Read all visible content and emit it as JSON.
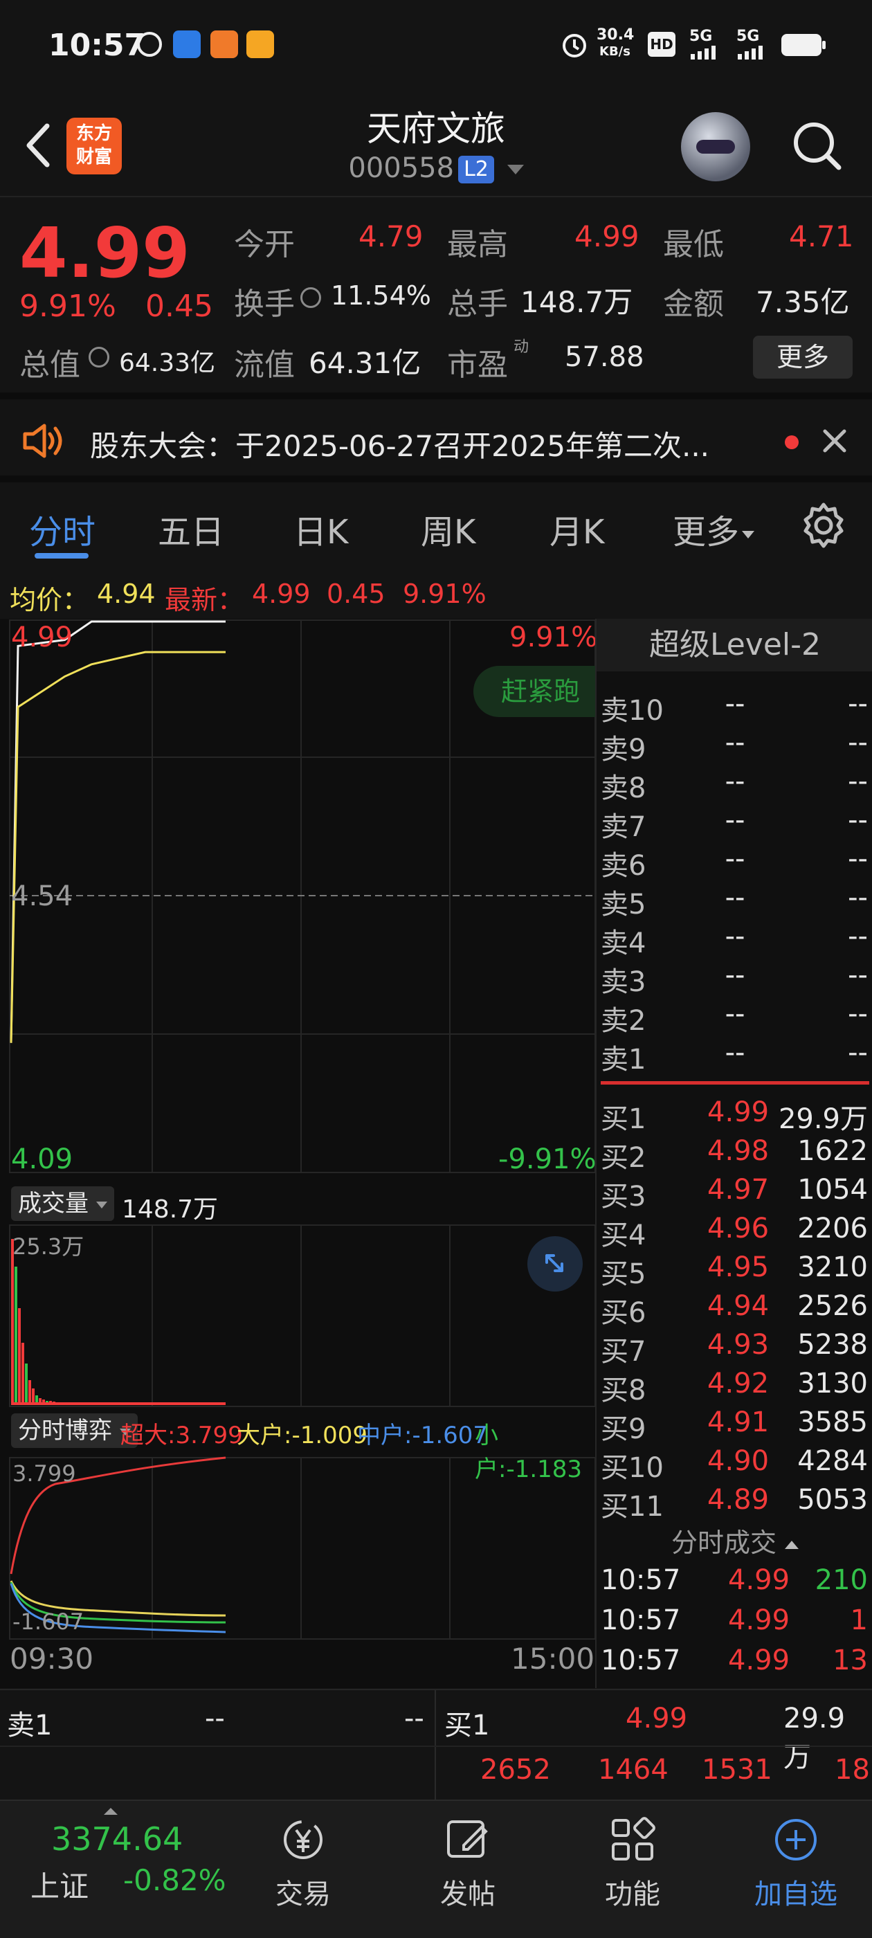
{
  "status_bar": {
    "time": "10:57",
    "speed_value": "30.4",
    "speed_unit": "KB/s",
    "network1": "5G",
    "network2": "5G",
    "icons": [
      "circle-k-icon",
      "app-icon-blue",
      "app-icon-orange",
      "app-icon-video",
      "alarm-icon",
      "hd-icon",
      "signal-icon",
      "battery-icon"
    ]
  },
  "header": {
    "logo_line1": "东方",
    "logo_line2": "财富",
    "title": "天府文旅",
    "code": "000558",
    "level_badge": "L2"
  },
  "quote": {
    "price": "4.99",
    "change_pct": "9.91%",
    "change": "0.45",
    "open_label": "今开",
    "open": "4.79",
    "high_label": "最高",
    "high": "4.99",
    "low_label": "最低",
    "low": "4.71",
    "turnover_label": "换手",
    "turnover": "11.54%",
    "volume_label": "总手",
    "volume": "148.7万",
    "amount_label": "金额",
    "amount": "7.35亿",
    "mcap_label": "总值",
    "mcap": "64.33亿",
    "float_label": "流值",
    "float": "64.31亿",
    "pe_label": "市盈",
    "pe_sup": "动",
    "pe": "57.88",
    "more": "更多"
  },
  "notice": {
    "text": "股东大会：于2025-06-27召开2025年第二次..."
  },
  "tabs": {
    "items": [
      "分时",
      "五日",
      "日K",
      "周K",
      "月K",
      "更多"
    ],
    "active": 0
  },
  "infoline": {
    "avg_label": "均价：",
    "avg": "4.94",
    "latest_label": "最新：",
    "latest": "4.99",
    "latest_chg": "0.45",
    "latest_pct": "9.91%"
  },
  "chart": {
    "price_top": "4.99",
    "pct_top": "9.91%",
    "price_mid": "4.54",
    "price_bottom": "4.09",
    "pct_bottom": "-9.91%",
    "badge": "赶紧跑",
    "volume_label": "成交量",
    "volume_value": "148.7万",
    "volume_max": "25.3万",
    "game_label": "分时博弈",
    "game_super": "超大:3.799",
    "game_large": "大户:-1.009",
    "game_mid": "中户:-1.607",
    "game_small": "小户:-1.183",
    "game_max": "3.799",
    "game_min": "-1.607",
    "time_start": "09:30",
    "time_end": "15:00"
  },
  "chart_data": {
    "type": "line",
    "title": "",
    "series": [
      {
        "name": "",
        "values": [
          4.3,
          4.95,
          4.96,
          4.99,
          4.99,
          4.99,
          4.99,
          4.99,
          4.99
        ]
      },
      {
        "name": "",
        "values": [
          4.3,
          4.85,
          4.9,
          4.92,
          4.93,
          4.94,
          4.94,
          4.94,
          4.94
        ]
      }
    ],
    "ylim": [
      4.09,
      4.99
    ]
  },
  "orderbook": {
    "title": "超级Level-2",
    "asks": [
      {
        "label": "卖10",
        "price": "--",
        "vol": "--"
      },
      {
        "label": "卖9",
        "price": "--",
        "vol": "--"
      },
      {
        "label": "卖8",
        "price": "--",
        "vol": "--"
      },
      {
        "label": "卖7",
        "price": "--",
        "vol": "--"
      },
      {
        "label": "卖6",
        "price": "--",
        "vol": "--"
      },
      {
        "label": "卖5",
        "price": "--",
        "vol": "--"
      },
      {
        "label": "卖4",
        "price": "--",
        "vol": "--"
      },
      {
        "label": "卖3",
        "price": "--",
        "vol": "--"
      },
      {
        "label": "卖2",
        "price": "--",
        "vol": "--"
      },
      {
        "label": "卖1",
        "price": "--",
        "vol": "--"
      }
    ],
    "bids": [
      {
        "label": "买1",
        "price": "4.99",
        "vol": "29.9万"
      },
      {
        "label": "买2",
        "price": "4.98",
        "vol": "1622"
      },
      {
        "label": "买3",
        "price": "4.97",
        "vol": "1054"
      },
      {
        "label": "买4",
        "price": "4.96",
        "vol": "2206"
      },
      {
        "label": "买5",
        "price": "4.95",
        "vol": "3210"
      },
      {
        "label": "买6",
        "price": "4.94",
        "vol": "2526"
      },
      {
        "label": "买7",
        "price": "4.93",
        "vol": "5238"
      },
      {
        "label": "买8",
        "price": "4.92",
        "vol": "3130"
      },
      {
        "label": "买9",
        "price": "4.91",
        "vol": "3585"
      },
      {
        "label": "买10",
        "price": "4.90",
        "vol": "4284"
      },
      {
        "label": "买11",
        "price": "4.89",
        "vol": "5053"
      }
    ],
    "trades_title": "分时成交",
    "trades": [
      {
        "time": "10:57",
        "price": "4.99",
        "vol": "210",
        "color": "#33c24a"
      },
      {
        "time": "10:57",
        "price": "4.99",
        "vol": "1",
        "color": "#f23a3a"
      },
      {
        "time": "10:57",
        "price": "4.99",
        "vol": "13",
        "color": "#f23a3a"
      }
    ]
  },
  "bottom_ob": {
    "ask_label": "卖1",
    "ask_price": "--",
    "ask_vol": "--",
    "bid_label": "买1",
    "bid_price": "4.99",
    "bid_vol": "29.9万",
    "queue": [
      "2652",
      "1464",
      "1531",
      "18"
    ]
  },
  "navbar": {
    "index_value": "3374.64",
    "index_name": "上证",
    "index_change": "-0.82%",
    "items": [
      "交易",
      "发帖",
      "功能",
      "加自选"
    ]
  }
}
